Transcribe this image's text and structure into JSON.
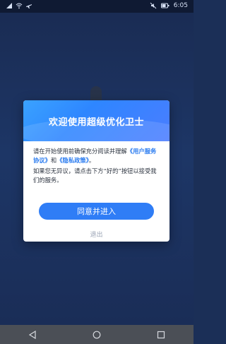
{
  "status_bar": {
    "time": "6:05",
    "left_icons": [
      "signal-icon",
      "wifi-icon",
      "airplane-icon"
    ],
    "right_icons": [
      "mute-icon",
      "battery-icon"
    ]
  },
  "dialog": {
    "title": "欢迎使用超级优化卫士",
    "body": {
      "line1_prefix": "请在开始使用前确保充分阅读并理解",
      "link_user_agreement": "《用户服务协议》",
      "and": "和",
      "link_privacy": "《隐私政策》",
      "line1_suffix": "。",
      "line2": "如果您无异议，请点击下方“好的”按钮以接受我们的服务。"
    },
    "agree_label": "同意并进入",
    "exit_label": "退出"
  },
  "nav_bar": {
    "buttons": [
      "back-icon",
      "home-icon",
      "recents-icon"
    ]
  },
  "colors": {
    "accent": "#2f7df6",
    "header_gradient_start": "#3aa2ff",
    "link": "#2b7cf0"
  }
}
